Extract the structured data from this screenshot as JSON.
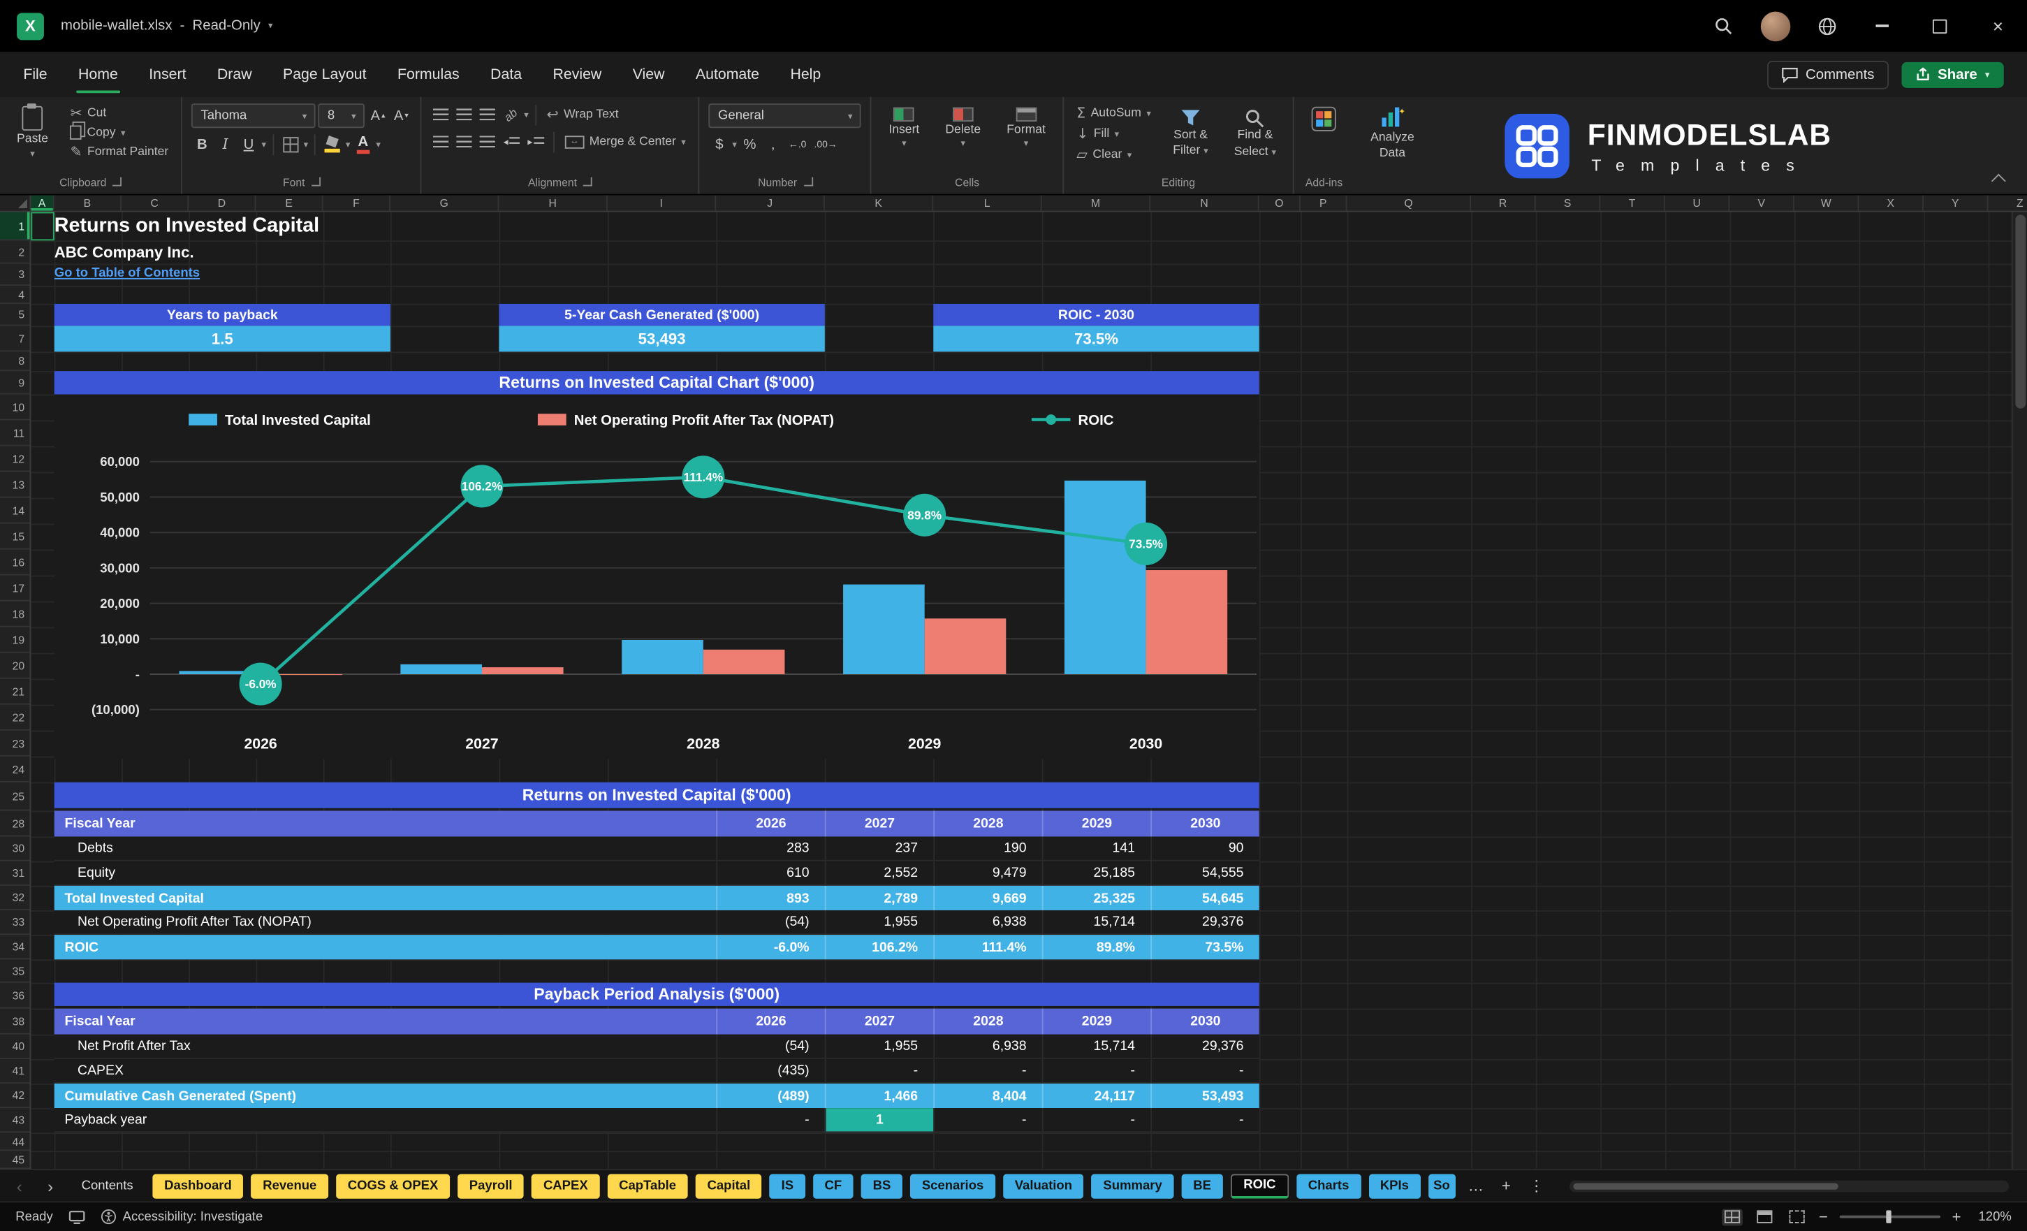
{
  "titlebar": {
    "filename": "mobile-wallet.xlsx",
    "separator": "-",
    "mode": "Read-Only"
  },
  "menubar": {
    "items": [
      "File",
      "Home",
      "Insert",
      "Draw",
      "Page Layout",
      "Formulas",
      "Data",
      "Review",
      "View",
      "Automate",
      "Help"
    ],
    "active": "Home",
    "comments": "Comments",
    "share": "Share"
  },
  "ribbon": {
    "clipboard": {
      "label": "Clipboard",
      "paste": "Paste",
      "cut": "Cut",
      "copy": "Copy",
      "format_painter": "Format Painter"
    },
    "font": {
      "label": "Font",
      "family": "Tahoma",
      "size": "8"
    },
    "alignment": {
      "label": "Alignment",
      "wrap": "Wrap Text",
      "merge": "Merge & Center"
    },
    "number": {
      "label": "Number",
      "format": "General"
    },
    "cells": {
      "label": "Cells",
      "insert": "Insert",
      "delete": "Delete",
      "format": "Format"
    },
    "editing": {
      "label": "Editing",
      "autosum": "AutoSum",
      "fill": "Fill",
      "clear": "Clear",
      "sort1": "Sort &",
      "sort2": "Filter",
      "find1": "Find &",
      "find2": "Select"
    },
    "addins": {
      "label": "Add-ins"
    },
    "analyze": {
      "line1": "Analyze",
      "line2": "Data"
    }
  },
  "brand": {
    "name": "FINMODELSLAB",
    "tagline": "Templates"
  },
  "grid": {
    "columns": [
      "A",
      "B",
      "C",
      "D",
      "E",
      "F",
      "G",
      "H",
      "I",
      "J",
      "K",
      "L",
      "M",
      "N",
      "O",
      "P",
      "Q",
      "R",
      "S",
      "T",
      "U",
      "V",
      "W",
      "X",
      "Y",
      "Z"
    ],
    "rows": [
      "1",
      "2",
      "3",
      "4",
      "5",
      "7",
      "8",
      "9",
      "10",
      "11",
      "12",
      "13",
      "14",
      "15",
      "16",
      "17",
      "18",
      "19",
      "20",
      "21",
      "22",
      "23",
      "24",
      "25",
      "28",
      "30",
      "31",
      "32",
      "33",
      "34",
      "35",
      "36",
      "38",
      "40",
      "41",
      "42",
      "43",
      "44",
      "45"
    ]
  },
  "doc": {
    "title": "Returns on Invested Capital",
    "company": "ABC Company Inc.",
    "link": "Go to Table of Contents"
  },
  "kpis": [
    {
      "label": "Years to payback",
      "value": "1.5"
    },
    {
      "label": "5-Year Cash Generated ($'000)",
      "value": "53,493"
    },
    {
      "label": "ROIC - 2030",
      "value": "73.5%"
    }
  ],
  "chart_data": {
    "type": "combo-bar-line",
    "title": "Returns on Invested Capital Chart ($'000)",
    "categories": [
      "2026",
      "2027",
      "2028",
      "2029",
      "2030"
    ],
    "series": [
      {
        "name": "Total Invested Capital",
        "type": "bar",
        "color": "#41b2e6",
        "values": [
          893,
          2789,
          9669,
          25325,
          54645
        ]
      },
      {
        "name": "Net Operating Profit After Tax (NOPAT)",
        "type": "bar",
        "color": "#ef7e72",
        "values": [
          -54,
          1955,
          6938,
          15714,
          29376
        ]
      },
      {
        "name": "ROIC",
        "type": "line",
        "axis": "secondary",
        "color": "#21b2a0",
        "values_pct": [
          -6.0,
          106.2,
          111.4,
          89.8,
          73.5
        ],
        "point_labels": [
          "-6.0%",
          "106.2%",
          "111.4%",
          "89.8%",
          "73.5%"
        ]
      }
    ],
    "y_ticks": [
      "60,000",
      "50,000",
      "40,000",
      "30,000",
      "20,000",
      "10,000",
      "-",
      "(10,000)"
    ],
    "ylim": [
      -10000,
      60000
    ],
    "grid": true,
    "legend_position": "top"
  },
  "tables": [
    {
      "title": "Returns on Invested Capital ($'000)",
      "header_label": "Fiscal Year",
      "years": [
        "2026",
        "2027",
        "2028",
        "2029",
        "2030"
      ],
      "rows": [
        {
          "label": "Debts",
          "indent": 1,
          "emphasis": false,
          "values": [
            "283",
            "237",
            "190",
            "141",
            "90"
          ]
        },
        {
          "label": "Equity",
          "indent": 1,
          "emphasis": false,
          "values": [
            "610",
            "2,552",
            "9,479",
            "25,185",
            "54,555"
          ]
        },
        {
          "label": "Total Invested Capital",
          "indent": 0,
          "emphasis": true,
          "values": [
            "893",
            "2,789",
            "9,669",
            "25,325",
            "54,645"
          ]
        },
        {
          "label": "Net Operating Profit After Tax (NOPAT)",
          "indent": 1,
          "emphasis": false,
          "values": [
            "(54)",
            "1,955",
            "6,938",
            "15,714",
            "29,376"
          ]
        },
        {
          "label": "ROIC",
          "indent": 0,
          "emphasis": true,
          "values": [
            "-6.0%",
            "106.2%",
            "111.4%",
            "89.8%",
            "73.5%"
          ]
        }
      ]
    },
    {
      "title": "Payback Period Analysis ($'000)",
      "header_label": "Fiscal Year",
      "years": [
        "2026",
        "2027",
        "2028",
        "2029",
        "2030"
      ],
      "rows": [
        {
          "label": "Net Profit After Tax",
          "indent": 1,
          "emphasis": false,
          "values": [
            "(54)",
            "1,955",
            "6,938",
            "15,714",
            "29,376"
          ]
        },
        {
          "label": "CAPEX",
          "indent": 1,
          "emphasis": false,
          "values": [
            "(435)",
            "-",
            "-",
            "-",
            "-"
          ]
        },
        {
          "label": "Cumulative Cash Generated (Spent)",
          "indent": 0,
          "emphasis": true,
          "values": [
            "(489)",
            "1,466",
            "8,404",
            "24,117",
            "53,493"
          ]
        },
        {
          "label": "Payback year",
          "indent": 0,
          "emphasis": false,
          "values": [
            "-",
            "1",
            "-",
            "-",
            "-"
          ],
          "highlight_col": 1
        }
      ]
    }
  ],
  "sheet_tabs": {
    "items": [
      {
        "label": "Contents",
        "color": "plain"
      },
      {
        "label": "Dashboard",
        "color": "yellow"
      },
      {
        "label": "Revenue",
        "color": "yellow"
      },
      {
        "label": "COGS & OPEX",
        "color": "yellow"
      },
      {
        "label": "Payroll",
        "color": "yellow"
      },
      {
        "label": "CAPEX",
        "color": "yellow"
      },
      {
        "label": "CapTable",
        "color": "yellow"
      },
      {
        "label": "Capital",
        "color": "yellow"
      },
      {
        "label": "IS",
        "color": "blue"
      },
      {
        "label": "CF",
        "color": "blue"
      },
      {
        "label": "BS",
        "color": "blue"
      },
      {
        "label": "Scenarios",
        "color": "blue"
      },
      {
        "label": "Valuation",
        "color": "blue"
      },
      {
        "label": "Summary",
        "color": "blue"
      },
      {
        "label": "BE",
        "color": "blue"
      },
      {
        "label": "ROIC",
        "color": "active"
      },
      {
        "label": "Charts",
        "color": "blue"
      },
      {
        "label": "KPIs",
        "color": "blue"
      },
      {
        "label": "So",
        "color": "blue",
        "truncated": true
      }
    ],
    "more": "…",
    "add": "+"
  },
  "statusbar": {
    "ready": "Ready",
    "accessibility": "Accessibility: Investigate",
    "zoom_out": "−",
    "zoom_in": "+",
    "zoom": "120%"
  }
}
